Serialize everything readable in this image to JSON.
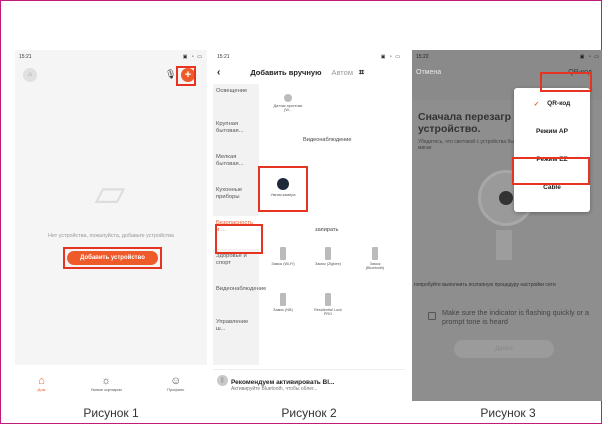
{
  "captions": [
    "Рисунок 1",
    "Рисунок 2",
    "Рисунок 3"
  ],
  "phone1": {
    "time": "15:21",
    "empty_text": "Нет устройства, пожалуйста, добавьте устройства",
    "add_button": "Добавить устройство",
    "tabs": [
      "Дом",
      "Умные сценарии",
      "Профиль"
    ]
  },
  "phone2": {
    "time": "15:21",
    "title": "Добавить вручную",
    "tab_right": "Автом",
    "categories": [
      "Освещение",
      "Крупная бытовая...",
      "Мелкая бытовая...",
      "Кухонные приборы",
      "Безопасность и ...",
      "Здоровье и спорт",
      "Видеонаблюдение",
      "Управление ш..."
    ],
    "top_device": "Датчик протечки (W...",
    "section_video": "Видеонаблюдение",
    "camera_label": "Умная камера",
    "section_lock": "запирать",
    "locks": [
      "Замок (Wi-Fi)",
      "Замок (Zigbee)",
      "Замок (Bluetooth)",
      "Замок (NB)",
      "Residential Lock PRO"
    ],
    "banner_title": "Рекомендуем активировать Bl...",
    "banner_sub": "Активируйте Bluetooth, чтобы облег..."
  },
  "phone3": {
    "time": "15:22",
    "cancel": "Отмена",
    "mode_button": "QR-код",
    "heading": "Сначала перезагр устройство.",
    "sub": "Убедитесь, что световой с устройства быстро мигае",
    "menu": [
      "QR-код",
      "Режим AP",
      "Режим EZ",
      "Cable"
    ],
    "hint": "попробуйте выполнить поэтапную процедуру настройки сети",
    "checkbox_text": "Make sure the indicator is flashing quickly or a prompt tone is heard",
    "next": "Далее"
  },
  "colors": {
    "accent": "#ef5a2a",
    "highlight": "#e53421"
  }
}
